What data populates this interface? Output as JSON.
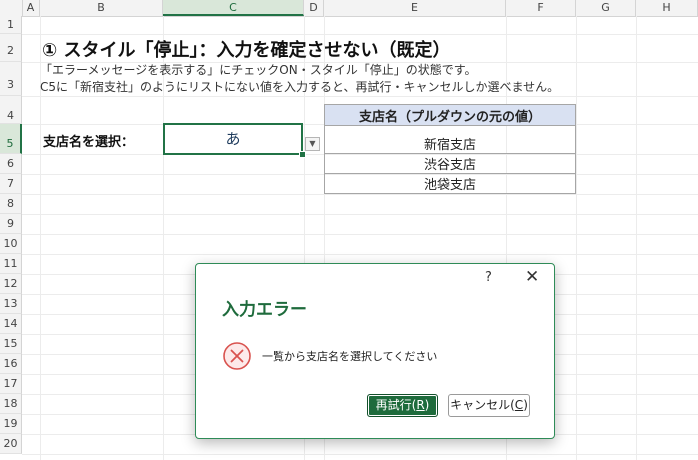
{
  "columns": [
    "A",
    "B",
    "C",
    "D",
    "E",
    "F",
    "G",
    "H"
  ],
  "active_column": "C",
  "rows": [
    "1",
    "2",
    "3",
    "4",
    "5",
    "6",
    "7",
    "8",
    "9",
    "10",
    "11",
    "12",
    "13",
    "14",
    "15",
    "16",
    "17",
    "18",
    "19",
    "20"
  ],
  "active_row": "5",
  "sheet": {
    "title": "① スタイル「停止」：入力を確定させない（既定）",
    "desc_line1": "「エラーメッセージを表示する」にチェックON・スタイル「停止」の状態です。",
    "desc_line2": "C5に「新宿支社」のようにリストにない値を入力すると、再試行・キャンセルしか選べません。",
    "select_label": "支店名を選択：",
    "input_value": "あ",
    "dropdown_icon": "chevron-down-icon",
    "list_header": "支店名（プルダウンの元の値）",
    "list_items": [
      "新宿支店",
      "渋谷支店",
      "池袋支店"
    ]
  },
  "dialog": {
    "help": "?",
    "close": "✕",
    "title": "入力エラー",
    "message": "一覧から支店名を選択してください",
    "icon": "error-circle-x-icon",
    "retry_text": "再試行(",
    "retry_key": "R",
    "retry_close": ")",
    "cancel_text": "キャンセル(",
    "cancel_key": "C",
    "cancel_close": ")"
  },
  "colors": {
    "accent": "#217346",
    "dialog_title": "#1e6b3c",
    "error_icon": "#d9534f",
    "list_header_bg": "#d9e1f2"
  }
}
